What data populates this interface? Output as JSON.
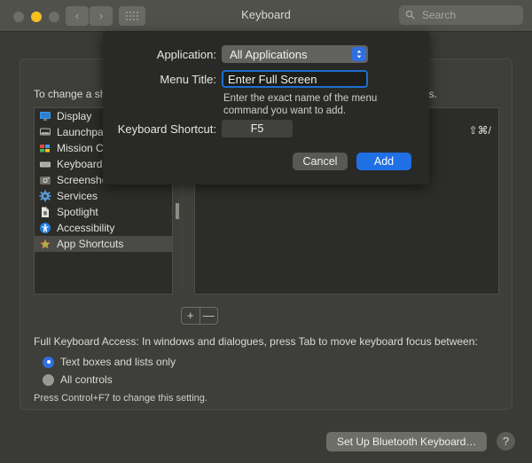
{
  "window": {
    "title": "Keyboard",
    "traffic_lights": [
      "close",
      "minimize",
      "zoom"
    ],
    "nav_back": "‹",
    "nav_forward": "›"
  },
  "search": {
    "placeholder": "Search",
    "value": "",
    "icon": "search-icon"
  },
  "main": {
    "intro_text": "To change a shortcut, select it, click the key combination, and then type the new keys.",
    "sidebar_items": [
      {
        "label": "Display",
        "icon": "display-icon",
        "selected": false
      },
      {
        "label": "Launchpad & Dock",
        "icon": "launchpad-icon",
        "selected": false
      },
      {
        "label": "Mission Control",
        "icon": "mission-control-icon",
        "selected": false
      },
      {
        "label": "Keyboard",
        "icon": "keyboard-icon",
        "selected": false
      },
      {
        "label": "Screenshots",
        "icon": "screenshots-icon",
        "selected": false
      },
      {
        "label": "Services",
        "icon": "services-icon",
        "selected": false
      },
      {
        "label": "Spotlight",
        "icon": "spotlight-icon",
        "selected": false
      },
      {
        "label": "Accessibility",
        "icon": "accessibility-icon",
        "selected": false
      },
      {
        "label": "App Shortcuts",
        "icon": "app-shortcuts-icon",
        "selected": true
      }
    ],
    "shortcut_rows": [
      {
        "name": "",
        "key": ""
      },
      {
        "name": "",
        "key": "⇧⌘/"
      }
    ],
    "add_button": "+",
    "remove_button": "—"
  },
  "full_keyboard_access": {
    "title": "Full Keyboard Access: In windows and dialogues, press Tab to move keyboard focus between:",
    "options": [
      {
        "label": "Text boxes and lists only",
        "selected": true
      },
      {
        "label": "All controls",
        "selected": false
      }
    ],
    "hint": "Press Control+F7 to change this setting."
  },
  "footer": {
    "bluetooth_button": "Set Up Bluetooth Keyboard…",
    "help_button": "?"
  },
  "sheet": {
    "application_label": "Application:",
    "application_value": "All Applications",
    "menu_title_label": "Menu Title:",
    "menu_title_value": "Enter Full Screen",
    "menu_title_hint": "Enter the exact name of the menu command you want to add.",
    "keyboard_shortcut_label": "Keyboard Shortcut:",
    "keyboard_shortcut_value": "F5",
    "cancel_button": "Cancel",
    "add_button": "Add"
  },
  "colors": {
    "accent_blue": "#1f6fe5",
    "window_bg": "#3a3a36",
    "titlebar_bg": "#51514c",
    "sheet_bg": "#292927",
    "list_bg": "#2c2c29",
    "amber_light": "#f5c021"
  }
}
